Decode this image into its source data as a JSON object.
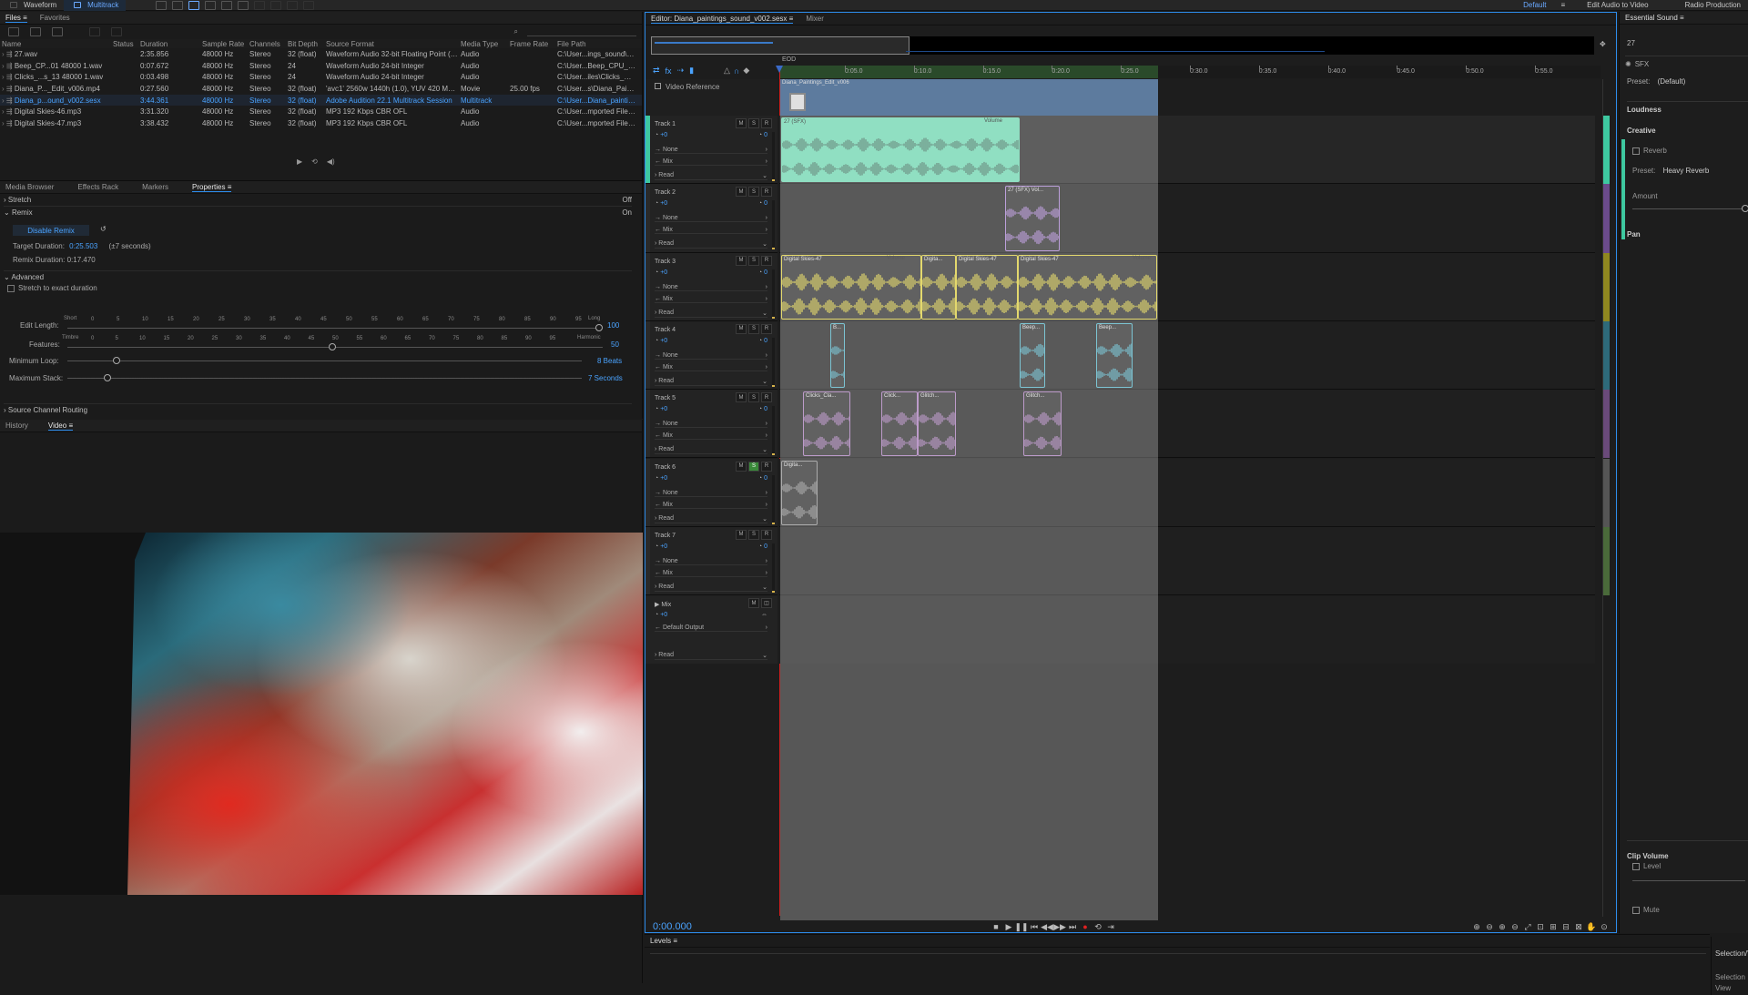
{
  "topbar": {
    "waveform": "Waveform",
    "multitrack": "Multitrack",
    "workspaces": [
      "Default",
      "Edit Audio to Video",
      "Radio Production"
    ]
  },
  "files_panel": {
    "tabs": [
      "Files",
      "Favorites"
    ],
    "columns": [
      "Name",
      "Status",
      "Duration",
      "Sample Rate",
      "Channels",
      "Bit Depth",
      "Source Format",
      "Media Type",
      "Frame Rate",
      "File Path"
    ],
    "rows": [
      {
        "name": "27.wav",
        "duration": "2:35.856",
        "rate": "48000 Hz",
        "ch": "Stereo",
        "bit": "32 (float)",
        "fmt": "Waveform Audio 32-bit Floating Point (IE...",
        "type": "Audio",
        "fr": "",
        "path": "C:\\User...ings_sound\\Imp",
        "sel": false
      },
      {
        "name": "Beep_CP...01 48000 1.wav",
        "duration": "0:07.672",
        "rate": "48000 Hz",
        "ch": "Stereo",
        "bit": "24",
        "fmt": "Waveform Audio 24-bit Integer",
        "type": "Audio",
        "fr": "",
        "path": "C:\\User...Beep_CPU_Noi",
        "sel": false
      },
      {
        "name": "Clicks_...s_13 48000 1.wav",
        "duration": "0:03.498",
        "rate": "48000 Hz",
        "ch": "Stereo",
        "bit": "24",
        "fmt": "Waveform Audio 24-bit Integer",
        "type": "Audio",
        "fr": "",
        "path": "C:\\User...iles\\Clicks_Clank",
        "sel": false
      },
      {
        "name": "Diana_P..._Edit_v006.mp4",
        "duration": "0:27.560",
        "rate": "48000 Hz",
        "ch": "Stereo",
        "bit": "32 (float)",
        "fmt": "'avc1' 2560w 1440h (1.0), YUV 420 MPEG...",
        "type": "Movie",
        "fr": "25.00 fps",
        "path": "C:\\User...s\\Diana_Painting",
        "sel": false
      },
      {
        "name": "Diana_p...ound_v002.sesx",
        "duration": "3:44.361",
        "rate": "48000 Hz",
        "ch": "Stereo",
        "bit": "32 (float)",
        "fmt": "Adobe Audition 22.1 Multitrack Session",
        "type": "Multitrack",
        "fr": "",
        "path": "C:\\User...Diana_painting",
        "sel": true
      },
      {
        "name": "Digital Skies-46.mp3",
        "duration": "3:31.320",
        "rate": "48000 Hz",
        "ch": "Stereo",
        "bit": "32 (float)",
        "fmt": "MP3 192 Kbps CBR OFL",
        "type": "Audio",
        "fr": "",
        "path": "C:\\User...mported Files\\Di",
        "sel": false
      },
      {
        "name": "Digital Skies-47.mp3",
        "duration": "3:38.432",
        "rate": "48000 Hz",
        "ch": "Stereo",
        "bit": "32 (float)",
        "fmt": "MP3 192 Kbps CBR OFL",
        "type": "Audio",
        "fr": "",
        "path": "C:\\User...mported Files\\Di",
        "sel": false
      }
    ]
  },
  "props_panel": {
    "tabs": [
      "Media Browser",
      "Effects Rack",
      "Markers",
      "Properties"
    ],
    "stretch": "Stretch",
    "stretch_state": "Off",
    "remix": "Remix",
    "remix_state": "On",
    "disable_remix": "Disable Remix",
    "target_duration_label": "Target Duration:",
    "target_duration": "0:25.503",
    "target_approx": "(±7 seconds)",
    "remix_duration": "Remix Duration: 0:17.470",
    "advanced": "Advanced",
    "stretch_exact": "Stretch to exact duration",
    "edit_length": "Edit Length:",
    "short": "Short",
    "long": "Long",
    "edit_value": "100",
    "features": "Features:",
    "timbre": "Timbre",
    "harmonic": "Harmonic",
    "features_value": "50",
    "min_loop": "Minimum Loop:",
    "min_loop_value": "8 Beats",
    "max_stack": "Maximum Stack:",
    "max_stack_value": "7 Seconds",
    "source_routing": "Source Channel Routing",
    "scale": [
      "0",
      "5",
      "10",
      "15",
      "20",
      "25",
      "30",
      "35",
      "40",
      "45",
      "50",
      "55",
      "60",
      "65",
      "70",
      "75",
      "80",
      "85",
      "90",
      "95"
    ]
  },
  "bottom_left": {
    "tabs": [
      "History",
      "Video"
    ]
  },
  "editor": {
    "tab": "Editor: Diana_paintings_sound_v002.sesx",
    "mixer": "Mixer",
    "eod": "EOD",
    "video_ref": "Video Reference",
    "video_clip": "Diana_Paintings_Edit_v006",
    "ruler": [
      "0:05.0",
      "0:10.0",
      "0:15.0",
      "0:20.0",
      "0:25.0",
      "0:30.0",
      "0:35.0",
      "0:40.0",
      "0:45.0",
      "0:50.0",
      "0:55.0"
    ],
    "timecode": "0:00.000",
    "levels": "Levels",
    "tracks": [
      {
        "name": "Track 1",
        "input": "None",
        "output": "Mix",
        "auto": "Read",
        "vol": "+0",
        "pan": "0",
        "solo": false
      },
      {
        "name": "Track 2",
        "input": "None",
        "output": "Mix",
        "auto": "Read",
        "vol": "+0",
        "pan": "0",
        "solo": false
      },
      {
        "name": "Track 3",
        "input": "None",
        "output": "Mix",
        "auto": "Read",
        "vol": "+0",
        "pan": "0",
        "solo": false
      },
      {
        "name": "Track 4",
        "input": "None",
        "output": "Mix",
        "auto": "Read",
        "vol": "+0",
        "pan": "0",
        "solo": false
      },
      {
        "name": "Track 5",
        "input": "None",
        "output": "Mix",
        "auto": "Read",
        "vol": "+0",
        "pan": "0",
        "solo": false
      },
      {
        "name": "Track 6",
        "input": "None",
        "output": "Mix",
        "auto": "Read",
        "vol": "+0",
        "pan": "0",
        "solo": true
      },
      {
        "name": "Track 7",
        "input": "None",
        "output": "Mix",
        "auto": "Read",
        "vol": "+0",
        "pan": "0",
        "solo": false
      }
    ],
    "mix": {
      "name": "Mix",
      "vol": "+0",
      "output": "Default Output",
      "auto": "Read"
    },
    "clip_labels": {
      "t1": "27 (SFX)",
      "t1vol": "Volume",
      "t2": "27 (SFX) Vol...",
      "t3a": "Digital Skies-47",
      "t3b": "Digita...",
      "t3c": "Digital Skies-47",
      "t3d": "Digital Skies-47",
      "vol": "Volume",
      "t4a": "B...",
      "t4b": "Beep...",
      "t4c": "Beep...",
      "t5a": "Clicks_Cla...",
      "t5b": "Click...",
      "t5c": "Glitch...",
      "t5d": "Glitch...",
      "t6": "Digita..."
    }
  },
  "essential": {
    "title": "Essential Sound",
    "count": "27",
    "type": "SFX",
    "preset_label": "Preset:",
    "preset": "(Default)",
    "loudness": "Loudness",
    "creative": "Creative",
    "reverb": "Reverb",
    "reverb_preset_label": "Preset:",
    "reverb_preset": "Heavy Reverb",
    "amount": "Amount",
    "pan": "Pan",
    "clip_volume": "Clip Volume",
    "level": "Level",
    "mute": "Mute",
    "selection": "Selection/V",
    "selection2": "Selection",
    "view": "View"
  }
}
